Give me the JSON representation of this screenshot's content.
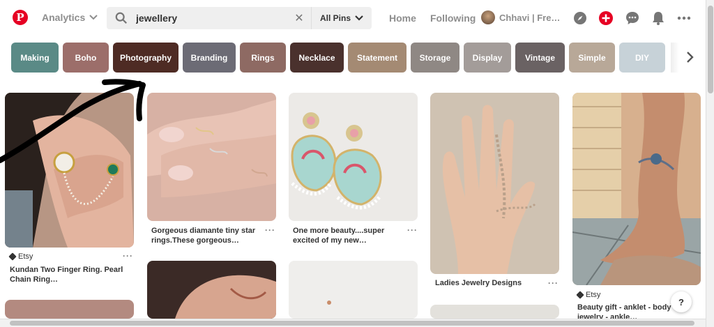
{
  "header": {
    "logo_letter": "P",
    "analytics_label": "Analytics",
    "search": {
      "value": "jewellery",
      "scope": "All Pins"
    },
    "nav": {
      "home": "Home",
      "following": "Following"
    },
    "profile_name": "Chhavi | Fre…",
    "icons": [
      "compass-icon",
      "add-icon",
      "chat-icon",
      "bell-icon",
      "more-icon"
    ],
    "accent": "#e60023"
  },
  "chips": [
    {
      "label": "Making",
      "color": "#5a8a86"
    },
    {
      "label": "Boho",
      "color": "#9c6e6a"
    },
    {
      "label": "Photography",
      "color": "#4e2b24"
    },
    {
      "label": "Branding",
      "color": "#6c6b75"
    },
    {
      "label": "Rings",
      "color": "#8e6a63"
    },
    {
      "label": "Necklace",
      "color": "#4a312d"
    },
    {
      "label": "Statement",
      "color": "#a48a73"
    },
    {
      "label": "Storage",
      "color": "#8f8884"
    },
    {
      "label": "Display",
      "color": "#a39c99"
    },
    {
      "label": "Vintage",
      "color": "#6a6263"
    },
    {
      "label": "Simple",
      "color": "#b8a898"
    },
    {
      "label": "DIY",
      "color": "#c7d2d8"
    }
  ],
  "pins": [
    {
      "source": "Etsy",
      "title_line1": "Kundan Two Finger Ring. Pearl",
      "title_line2": "Chain Ring…"
    },
    {
      "title_line1": "Gorgeous diamante tiny star",
      "title_line2": "rings.These gorgeous…"
    },
    {
      "title_line1": "One more beauty....super",
      "title_line2": "excited of my new…"
    },
    {
      "title_line1": "Ladies Jewelry Designs"
    },
    {
      "source": "Etsy",
      "title_line1": "Beauty gift - anklet - body",
      "title_line2": "jewelry - ankle…"
    }
  ],
  "more_label": "···",
  "help_label": "?"
}
